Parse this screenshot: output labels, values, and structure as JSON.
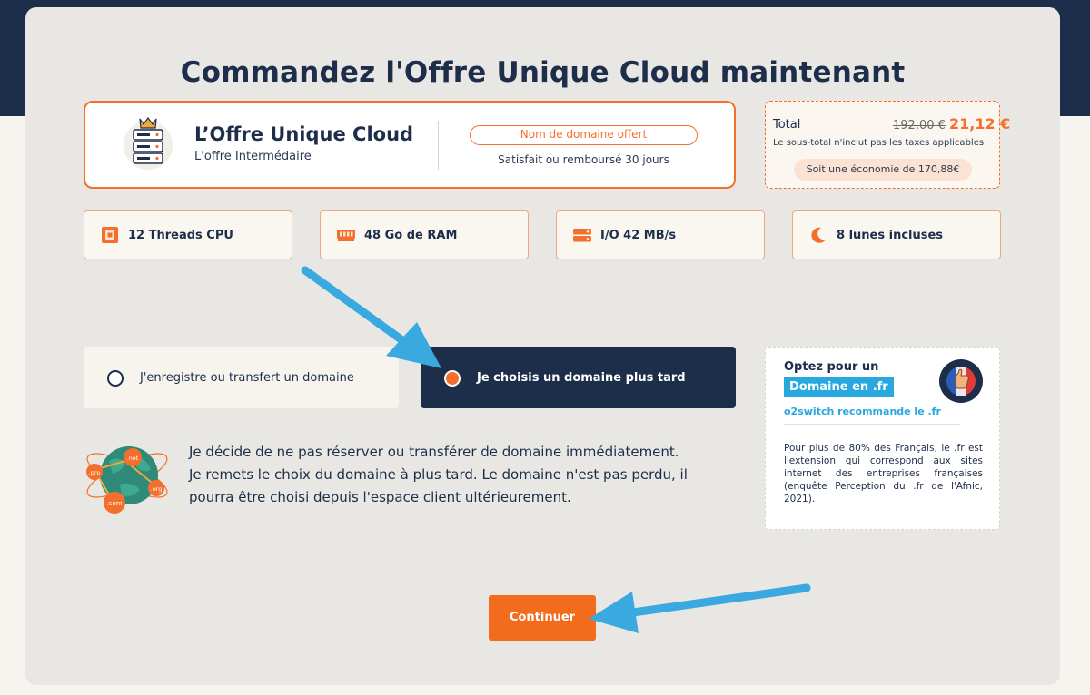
{
  "page": {
    "title": "Commandez l'Offre Unique Cloud maintenant"
  },
  "offer": {
    "name": "L’Offre Unique Cloud",
    "tier": "L'offre Intermédaire",
    "badge": "Nom de domaine offert",
    "guarantee": "Satisfait ou remboursé 30 jours"
  },
  "total": {
    "label": "Total",
    "old_price": "192,00 €",
    "new_price": "21,12 €",
    "tax_note": "Le sous-total n'inclut pas les taxes applicables",
    "savings": "Soit une économie de 170,88€"
  },
  "specs": [
    {
      "label": "12 Threads CPU",
      "icon": "cpu-icon"
    },
    {
      "label": "48 Go de RAM",
      "icon": "ram-icon"
    },
    {
      "label": "I/O 42 MB/s",
      "icon": "disk-icon"
    },
    {
      "label": "8 lunes incluses",
      "icon": "moon-icon"
    }
  ],
  "domain_options": [
    {
      "label": "J'enregistre ou transfert un domaine",
      "selected": false
    },
    {
      "label": "Je choisis un domaine plus tard",
      "selected": true
    }
  ],
  "explanation": {
    "lines": [
      "Je décide de ne pas réserver ou transférer de domaine immédiatement.",
      "Je remets le choix du domaine à plus tard. Le domaine n'est pas perdu, il",
      "pourra être choisi depuis l'espace client ultérieurement."
    ],
    "globe_tags": [
      ".pro",
      ".net",
      ".com",
      ".org"
    ]
  },
  "promo": {
    "title": "Optez pour un",
    "highlight": "Domaine en .fr",
    "recommend": "o2switch recommande le .fr",
    "body": "Pour plus de 80% des Français, le .fr est l'extension qui correspond aux sites internet des entreprises françaises (enquête Perception du .fr de l'Afnic, 2021)."
  },
  "actions": {
    "continue_label": "Continuer"
  },
  "colors": {
    "navy": "#1c2e4a",
    "orange": "#f36f2b",
    "annotation_arrow": "#3aa9e0",
    "promo_blue": "#29a8e0"
  }
}
